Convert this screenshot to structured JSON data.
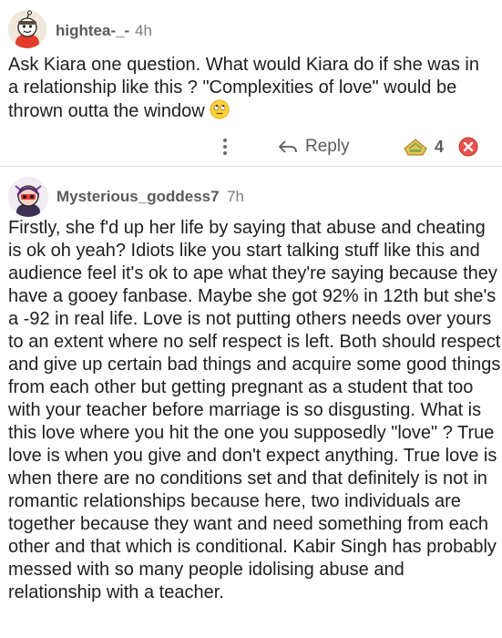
{
  "comments": [
    {
      "username": "hightea-_-",
      "age": "4h",
      "text": "Ask Kiara one question. What would Kiara do if she was in a relationship like this ? \"Complexities of love\" would be thrown outta the window",
      "emoji": "rolling-eyes-emoji",
      "actions": {
        "more_icon": "more-vertical-icon",
        "reply_label": "Reply",
        "score": "4",
        "upvote_icon": "upvote-award-icon",
        "downvote_icon": "downvote-x-icon"
      }
    },
    {
      "username": "Mysterious_goddess7",
      "age": "7h",
      "text": "Firstly, she f'd up her life by saying that abuse and cheating is ok oh yeah? Idiots like you start talking stuff like this and audience feel it's ok to ape what they're saying because they have a gooey fanbase. Maybe she got 92% in 12th but she's a -92 in real life. Love is not putting others needs over yours to an extent where no self respect is left. Both should respect and give up certain bad things and acquire some good things from each other but getting pregnant as a student that too with your teacher before marriage is so disgusting. What is this love where you hit the one you supposedly \"love\" ? True love is when you give and don't expect anything. True love is when there are no conditions set and that definitely is not in romantic relationships because here, two individuals are together because they want and need something from each other and that which is conditional. Kabir Singh has probably messed with so many people idolising abuse and relationship with a teacher."
    }
  ],
  "colors": {
    "upvote": "#e0b640",
    "downvote": "#e8524a",
    "meta_text": "#7c7c7c"
  }
}
